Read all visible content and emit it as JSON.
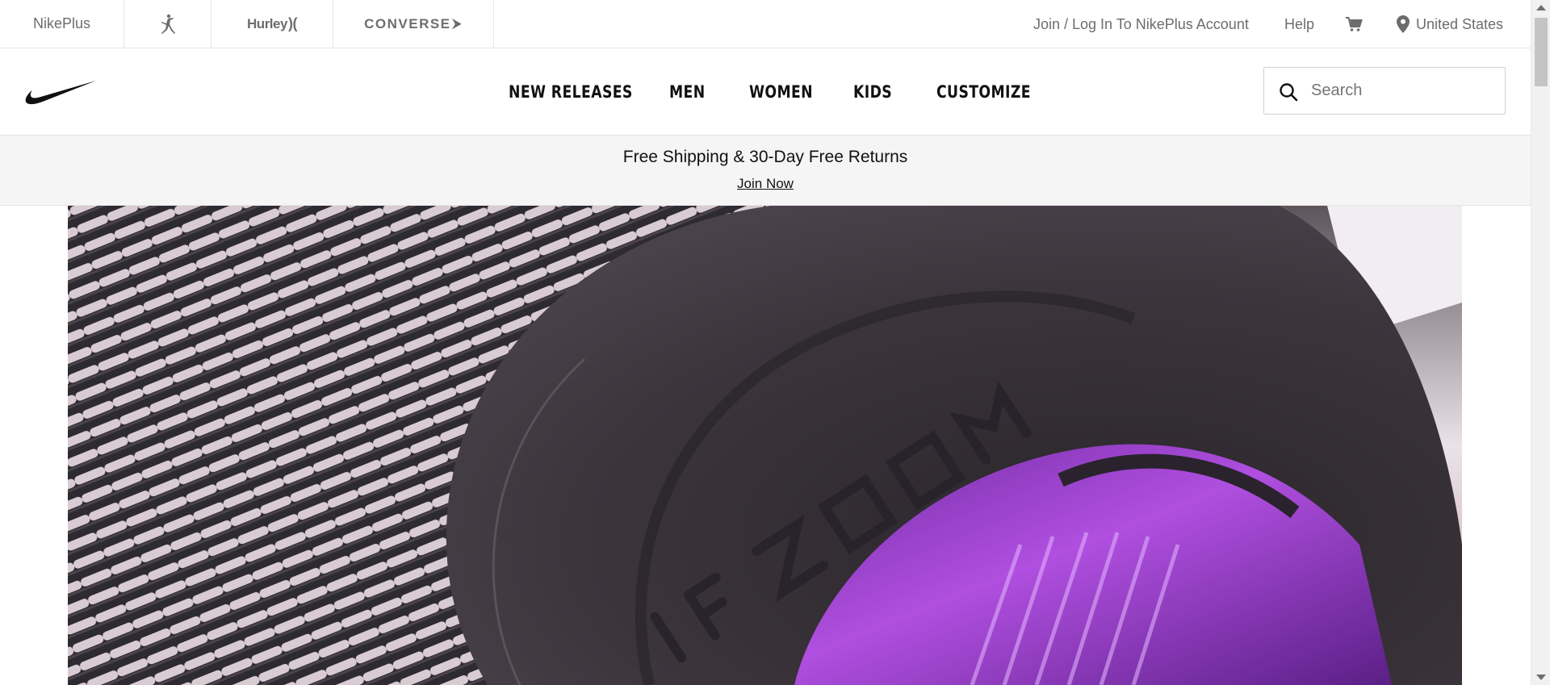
{
  "brand_bar": {
    "nikeplus_label": "NikePlus",
    "jordan_icon": "jumpman-icon",
    "hurley_label": "Hurley",
    "hurley_mark": ")(",
    "converse_label": "CONVERSE",
    "converse_mark": "⮞"
  },
  "utility": {
    "account_label": "Join / Log In To NikePlus Account",
    "help_label": "Help",
    "cart_icon": "cart-icon",
    "region_icon": "location-pin-icon",
    "region_label": "United States"
  },
  "nav": {
    "logo_icon": "nike-swoosh-icon",
    "items": [
      {
        "label": "NEW RELEASES"
      },
      {
        "label": "MEN"
      },
      {
        "label": "WOMEN"
      },
      {
        "label": "KIDS"
      },
      {
        "label": "CUSTOMIZE"
      }
    ],
    "search": {
      "placeholder": "Search",
      "value": "",
      "icon": "search-icon"
    }
  },
  "promo": {
    "title": "Free Shipping & 30-Day Free Returns",
    "link_label": "Join Now"
  },
  "hero": {
    "image": "close-up of sneaker with Air Zoom unit",
    "colors": {
      "mesh_light": "#d6c9cf",
      "mesh_dark": "#2f2a32",
      "sole": "#3a3339",
      "zoom_purple": "#9b3fd0"
    }
  },
  "colors": {
    "text_primary": "#111111",
    "text_secondary": "#6d6d6d",
    "divider": "#e5e5e5",
    "promo_bg": "#f5f5f5"
  }
}
